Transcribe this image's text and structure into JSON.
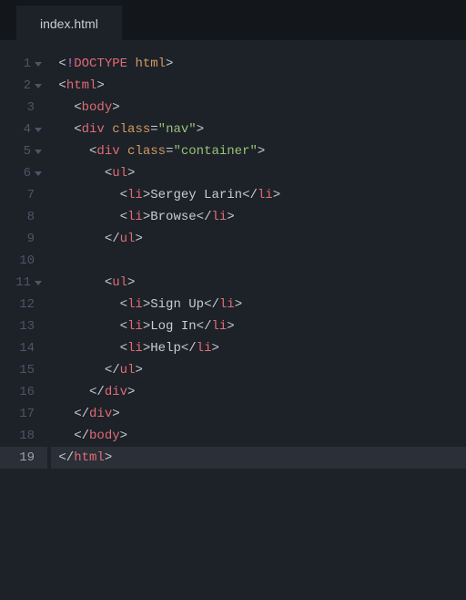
{
  "tab": {
    "label": "index.html"
  },
  "lines": [
    {
      "n": 1,
      "fold": true,
      "indent": 0,
      "segs": [
        [
          "pun",
          "<"
        ],
        [
          "bang",
          "!"
        ],
        [
          "doct",
          "DOCTYPE"
        ],
        [
          "txt",
          " "
        ],
        [
          "attr",
          "html"
        ],
        [
          "pun",
          ">"
        ]
      ]
    },
    {
      "n": 2,
      "fold": true,
      "indent": 0,
      "segs": [
        [
          "pun",
          "<"
        ],
        [
          "tagn",
          "html"
        ],
        [
          "pun",
          ">"
        ]
      ]
    },
    {
      "n": 3,
      "fold": false,
      "indent": 1,
      "segs": [
        [
          "pun",
          "<"
        ],
        [
          "tagn",
          "body"
        ],
        [
          "pun",
          ">"
        ]
      ]
    },
    {
      "n": 4,
      "fold": true,
      "indent": 1,
      "segs": [
        [
          "pun",
          "<"
        ],
        [
          "tagn",
          "div"
        ],
        [
          "txt",
          " "
        ],
        [
          "attr",
          "class"
        ],
        [
          "pun",
          "="
        ],
        [
          "str",
          "\"nav\""
        ],
        [
          "pun",
          ">"
        ]
      ]
    },
    {
      "n": 5,
      "fold": true,
      "indent": 2,
      "segs": [
        [
          "pun",
          "<"
        ],
        [
          "tagn",
          "div"
        ],
        [
          "txt",
          " "
        ],
        [
          "attr",
          "class"
        ],
        [
          "pun",
          "="
        ],
        [
          "str",
          "\"container\""
        ],
        [
          "pun",
          ">"
        ]
      ]
    },
    {
      "n": 6,
      "fold": true,
      "indent": 3,
      "segs": [
        [
          "pun",
          "<"
        ],
        [
          "tagn",
          "ul"
        ],
        [
          "pun",
          ">"
        ]
      ]
    },
    {
      "n": 7,
      "fold": false,
      "indent": 4,
      "segs": [
        [
          "pun",
          "<"
        ],
        [
          "tagn",
          "li"
        ],
        [
          "pun",
          ">"
        ],
        [
          "txt",
          "Sergey Larin"
        ],
        [
          "pun",
          "</"
        ],
        [
          "tagn",
          "li"
        ],
        [
          "pun",
          ">"
        ]
      ]
    },
    {
      "n": 8,
      "fold": false,
      "indent": 4,
      "segs": [
        [
          "pun",
          "<"
        ],
        [
          "tagn",
          "li"
        ],
        [
          "pun",
          ">"
        ],
        [
          "txt",
          "Browse"
        ],
        [
          "pun",
          "</"
        ],
        [
          "tagn",
          "li"
        ],
        [
          "pun",
          ">"
        ]
      ]
    },
    {
      "n": 9,
      "fold": false,
      "indent": 3,
      "segs": [
        [
          "pun",
          "</"
        ],
        [
          "tagn",
          "ul"
        ],
        [
          "pun",
          ">"
        ]
      ]
    },
    {
      "n": 10,
      "fold": false,
      "indent": 3,
      "segs": []
    },
    {
      "n": 11,
      "fold": true,
      "indent": 3,
      "segs": [
        [
          "pun",
          "<"
        ],
        [
          "tagn",
          "ul"
        ],
        [
          "pun",
          ">"
        ]
      ]
    },
    {
      "n": 12,
      "fold": false,
      "indent": 4,
      "segs": [
        [
          "pun",
          "<"
        ],
        [
          "tagn",
          "li"
        ],
        [
          "pun",
          ">"
        ],
        [
          "txt",
          "Sign Up"
        ],
        [
          "pun",
          "</"
        ],
        [
          "tagn",
          "li"
        ],
        [
          "pun",
          ">"
        ]
      ]
    },
    {
      "n": 13,
      "fold": false,
      "indent": 4,
      "segs": [
        [
          "pun",
          "<"
        ],
        [
          "tagn",
          "li"
        ],
        [
          "pun",
          ">"
        ],
        [
          "txt",
          "Log In"
        ],
        [
          "pun",
          "</"
        ],
        [
          "tagn",
          "li"
        ],
        [
          "pun",
          ">"
        ]
      ]
    },
    {
      "n": 14,
      "fold": false,
      "indent": 4,
      "segs": [
        [
          "pun",
          "<"
        ],
        [
          "tagn",
          "li"
        ],
        [
          "pun",
          ">"
        ],
        [
          "txt",
          "Help"
        ],
        [
          "pun",
          "</"
        ],
        [
          "tagn",
          "li"
        ],
        [
          "pun",
          ">"
        ]
      ]
    },
    {
      "n": 15,
      "fold": false,
      "indent": 3,
      "segs": [
        [
          "pun",
          "</"
        ],
        [
          "tagn",
          "ul"
        ],
        [
          "pun",
          ">"
        ]
      ]
    },
    {
      "n": 16,
      "fold": false,
      "indent": 2,
      "segs": [
        [
          "pun",
          "</"
        ],
        [
          "tagn",
          "div"
        ],
        [
          "pun",
          ">"
        ]
      ]
    },
    {
      "n": 17,
      "fold": false,
      "indent": 1,
      "segs": [
        [
          "pun",
          "</"
        ],
        [
          "tagn",
          "div"
        ],
        [
          "pun",
          ">"
        ]
      ]
    },
    {
      "n": 18,
      "fold": false,
      "indent": 1,
      "segs": [
        [
          "pun",
          "</"
        ],
        [
          "tagn",
          "body"
        ],
        [
          "pun",
          ">"
        ]
      ]
    },
    {
      "n": 19,
      "fold": false,
      "indent": 0,
      "hl": true,
      "segs": [
        [
          "pun",
          "</"
        ],
        [
          "tagn",
          "html"
        ],
        [
          "pun",
          ">"
        ]
      ]
    }
  ]
}
